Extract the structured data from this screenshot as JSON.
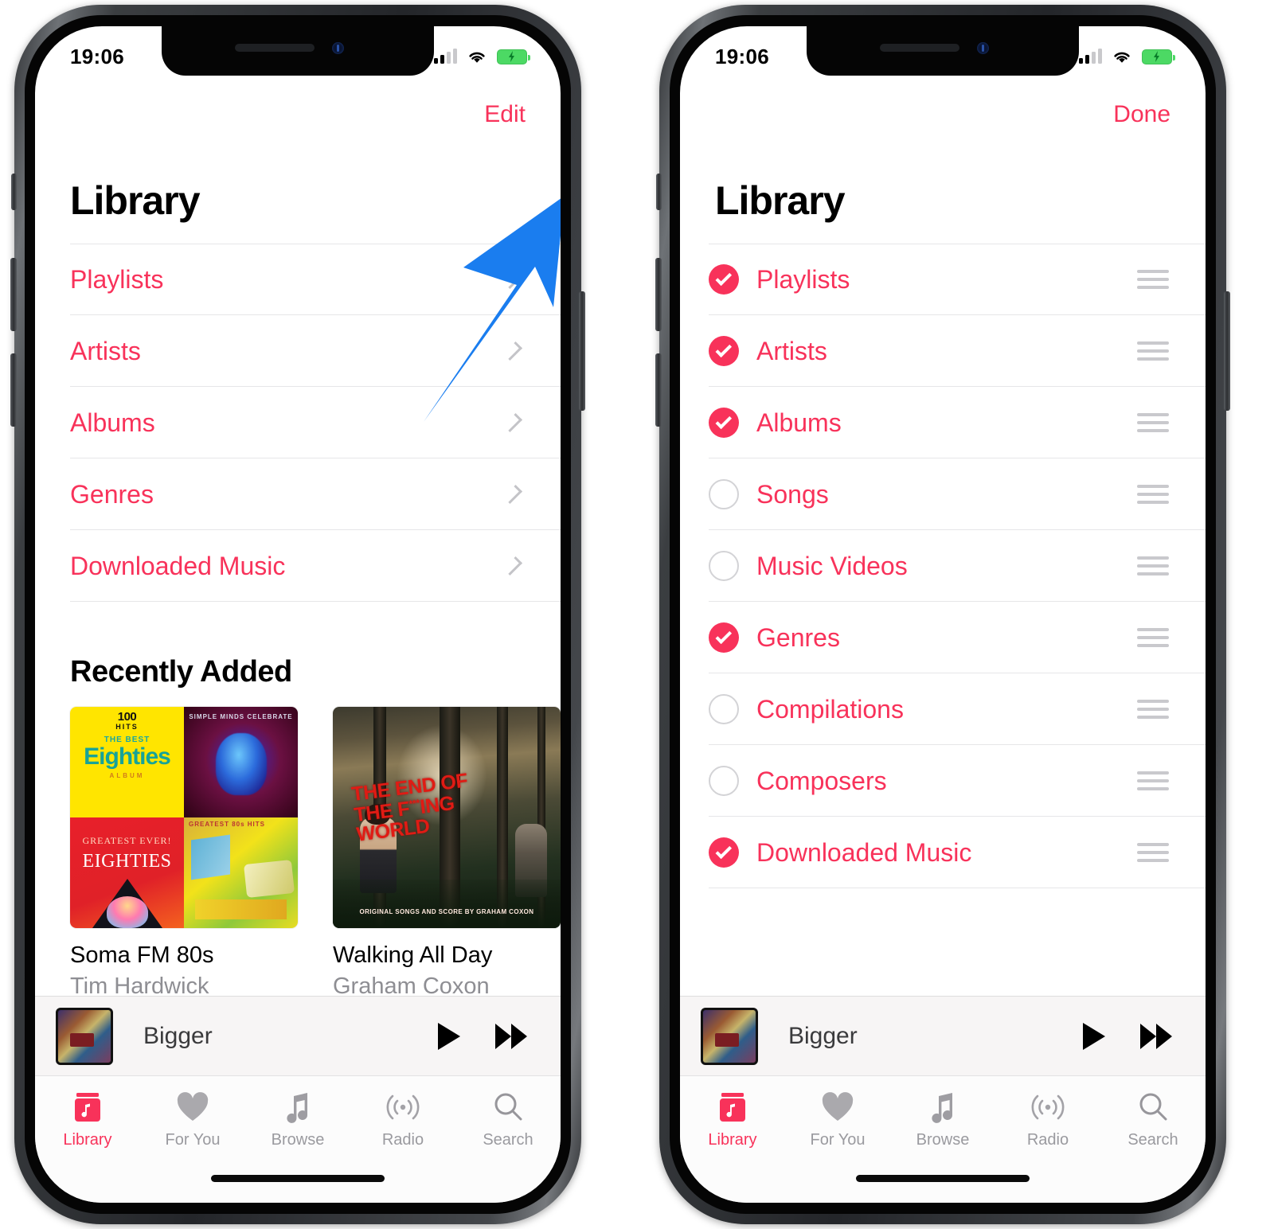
{
  "status_bar": {
    "time": "19:06",
    "signal_icon": "cellular-bars-icon",
    "wifi_icon": "wifi-icon",
    "battery_icon": "battery-charging-icon"
  },
  "colors": {
    "accent_pink": "#f8325a",
    "arrow_blue": "#1a7def",
    "separator": "#e6e6e8",
    "secondary_text": "#8e8e93",
    "grip_gray": "#c9c9cd"
  },
  "left_phone": {
    "nav_action": "Edit",
    "page_title": "Library",
    "list_items": [
      {
        "label": "Playlists"
      },
      {
        "label": "Artists"
      },
      {
        "label": "Albums"
      },
      {
        "label": "Genres"
      },
      {
        "label": "Downloaded Music"
      }
    ],
    "section_title": "Recently Added",
    "cards": [
      {
        "title": "Soma FM 80s",
        "subtitle": "Tim Hardwick",
        "art_texts": {
          "hits_number": "100",
          "hits_word": "HITS",
          "best": "THE BEST",
          "eighties": "Eighties",
          "album_word": "ALBUM",
          "simple_minds": "SIMPLE MINDS CELEBRATE",
          "greatest": "GREATEST EVER!",
          "eighties_caps": "EIGHTIES",
          "q4_top": "GREATEST 80s HITS"
        }
      },
      {
        "title": "Walking All Day",
        "subtitle": "Graham Coxon",
        "art_texts": {
          "line1": "THE END OF",
          "line2": "THE F",
          "line2_sup": "***",
          "line2_end": "ING",
          "line3": "WORLD",
          "credit": "ORIGINAL SONGS AND SCORE BY GRAHAM COXON"
        }
      }
    ]
  },
  "right_phone": {
    "nav_action": "Done",
    "page_title": "Library",
    "edit_items": [
      {
        "label": "Playlists",
        "selected": true
      },
      {
        "label": "Artists",
        "selected": true
      },
      {
        "label": "Albums",
        "selected": true
      },
      {
        "label": "Songs",
        "selected": false
      },
      {
        "label": "Music Videos",
        "selected": false
      },
      {
        "label": "Genres",
        "selected": true
      },
      {
        "label": "Compilations",
        "selected": false
      },
      {
        "label": "Composers",
        "selected": false
      },
      {
        "label": "Downloaded Music",
        "selected": true
      }
    ]
  },
  "mini_player": {
    "track_title": "Bigger",
    "play_label": "play-button",
    "next_label": "fast-forward-button"
  },
  "tab_bar": {
    "tabs": [
      {
        "label": "Library",
        "icon": "library-icon",
        "active": true
      },
      {
        "label": "For You",
        "icon": "heart-icon",
        "active": false
      },
      {
        "label": "Browse",
        "icon": "music-note-icon",
        "active": false
      },
      {
        "label": "Radio",
        "icon": "radio-waves-icon",
        "active": false
      },
      {
        "label": "Search",
        "icon": "search-icon",
        "active": false
      }
    ]
  },
  "annotation": {
    "arrow_icon": "blue-arrow-pointing-up-right",
    "points_to": "Edit"
  }
}
